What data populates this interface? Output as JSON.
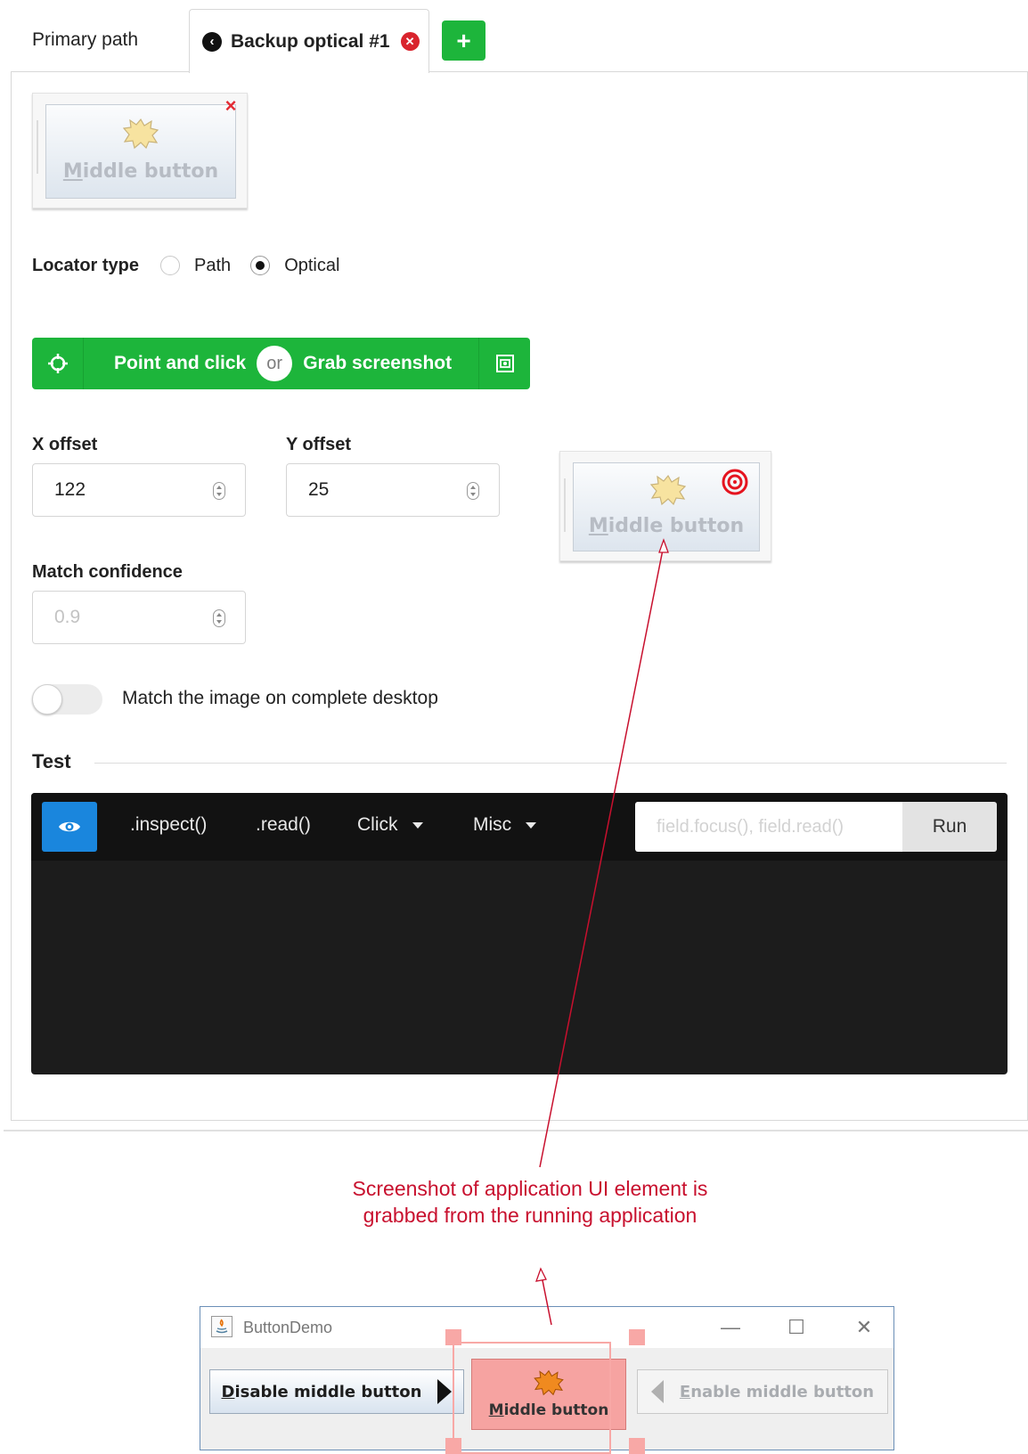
{
  "tabs": {
    "primary": "Primary path",
    "backup": "Backup optical #1",
    "add": "+"
  },
  "image_thumb": {
    "label_first": "M",
    "label_rest": "iddle button",
    "remove": "×"
  },
  "locator": {
    "label": "Locator type",
    "options": [
      "Path",
      "Optical"
    ],
    "selected": "Optical"
  },
  "capture": {
    "point_click": "Point and click",
    "or": "or",
    "grab": "Grab screenshot"
  },
  "x_offset": {
    "label": "X offset",
    "value": "122"
  },
  "y_offset": {
    "label": "Y offset",
    "value": "25"
  },
  "confidence": {
    "label": "Match confidence",
    "placeholder": "0.9"
  },
  "toggle": {
    "label": "Match the image on complete desktop",
    "on": false
  },
  "test": {
    "heading": "Test",
    "inspect": ".inspect()",
    "read": ".read()",
    "click": "Click",
    "misc": "Misc",
    "input_placeholder": "field.focus(), field.read()",
    "run": "Run"
  },
  "annotation": "Screenshot of application UI element is grabbed from the running application",
  "demo": {
    "title": "ButtonDemo",
    "min": "—",
    "max": "☐",
    "close": "✕",
    "disable_first": "D",
    "disable_rest": "isable middle button",
    "middle_first": "M",
    "middle_rest": "iddle button",
    "enable_first": "E",
    "enable_rest": "nable middle button"
  },
  "colors": {
    "green": "#1db53b",
    "annotation_red": "#c8102e",
    "accent_blue": "#1a86dd",
    "console_bg": "#1c1c1c"
  }
}
